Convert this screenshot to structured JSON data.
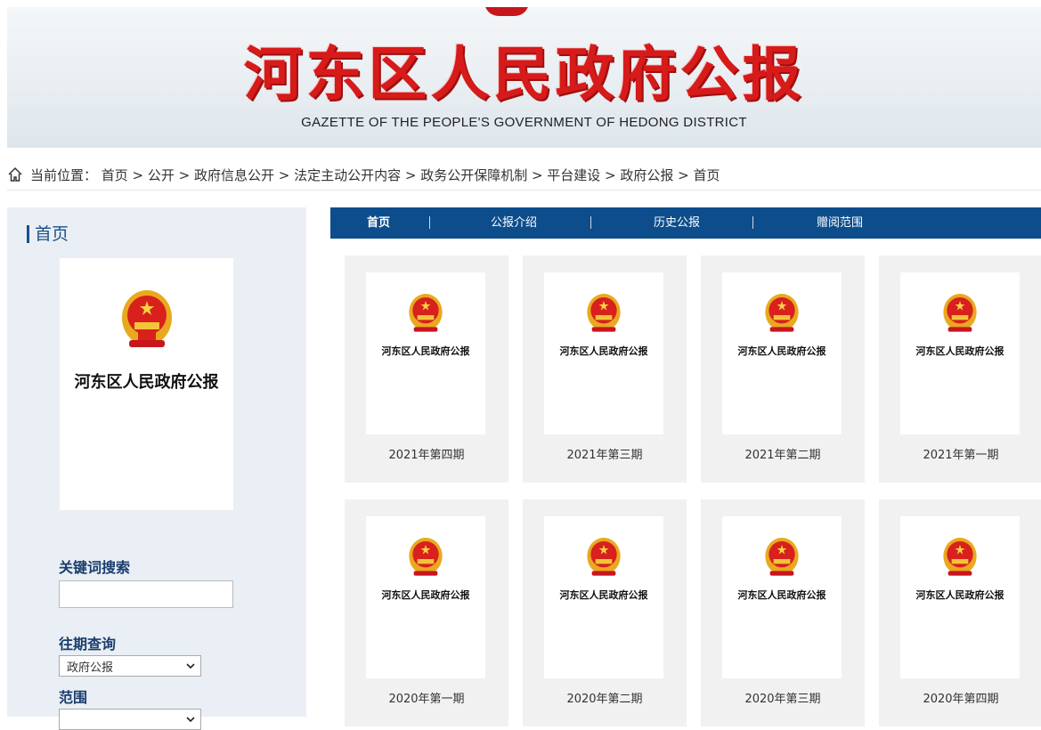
{
  "banner": {
    "title": "河东区人民政府公报",
    "subtitle": "GAZETTE OF THE PEOPLE'S GOVERNMENT OF HEDONG DISTRICT"
  },
  "breadcrumb": {
    "icon": "home-icon",
    "text": "当前位置： 首页 > 公开 > 政府信息公开 > 法定主动公开内容 > 政务公开保障机制 > 平台建设 > 政府公报 > 首页"
  },
  "sidebar": {
    "heading": "首页",
    "cover_title": "河东区人民政府公报",
    "keyword_label": "关键词搜索",
    "keyword_value": "",
    "archive_label": "往期查询",
    "archive_selected": "政府公报",
    "scope_label": "范围",
    "scope_selected": ""
  },
  "nav": {
    "items": [
      "首页",
      "公报介绍",
      "历史公报",
      "赠阅范围"
    ],
    "separator": "|"
  },
  "issues": {
    "page_title": "河东区人民政府公报",
    "row1": [
      "2021年第四期",
      "2021年第三期",
      "2021年第二期",
      "2021年第一期"
    ],
    "row2": [
      "2020年第一期",
      "2020年第二期",
      "2020年第三期",
      "2020年第四期"
    ]
  },
  "colors": {
    "nav_bg": "#0d4d8c",
    "title_red": "#d71a1a",
    "sidebar_bg": "#e9eff4",
    "card_bg": "#f1f1f1"
  }
}
